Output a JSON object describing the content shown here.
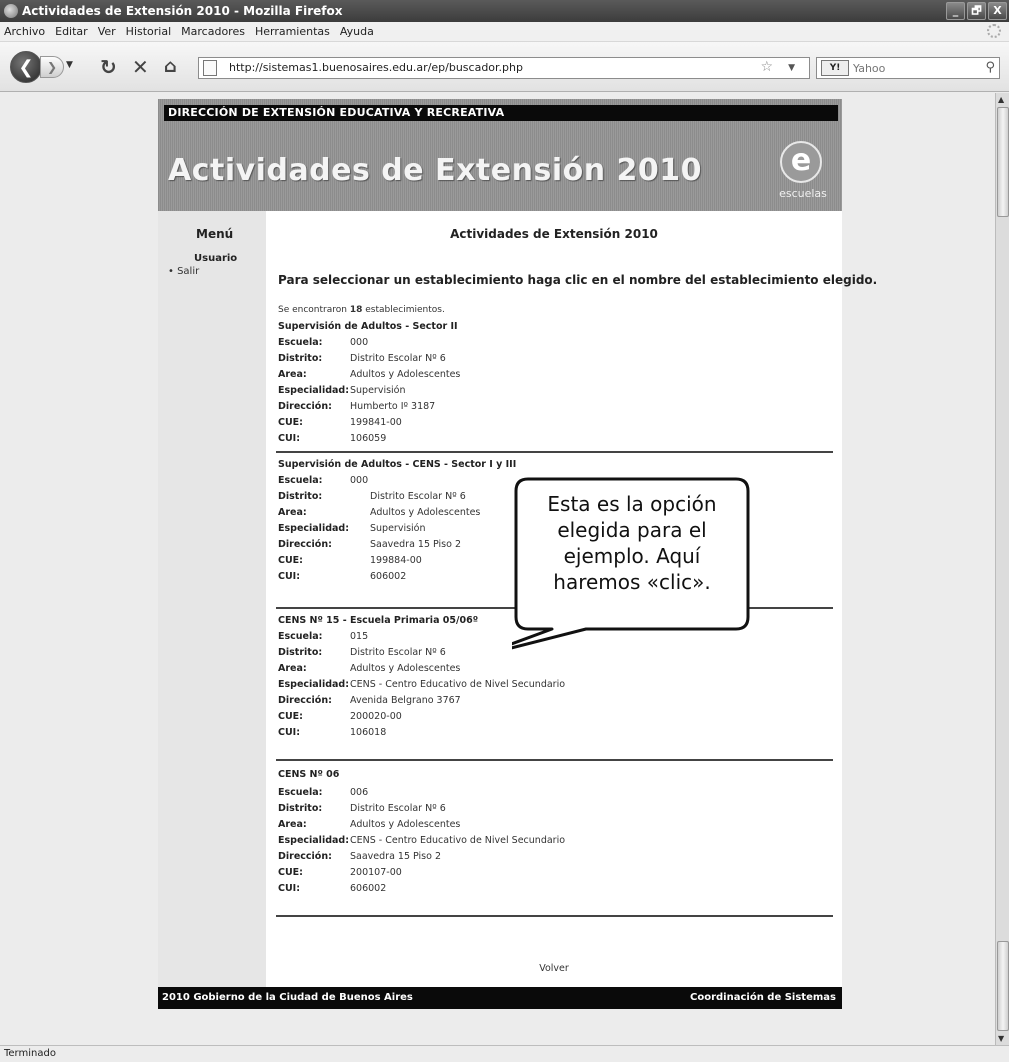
{
  "window": {
    "title": "Actividades de Extensión 2010 - Mozilla Firefox",
    "minimize": "_",
    "maximize": "🗗",
    "close": "X"
  },
  "menubar": [
    "Archivo",
    "Editar",
    "Ver",
    "Historial",
    "Marcadores",
    "Herramientas",
    "Ayuda"
  ],
  "navbar": {
    "url": "http://sistemas1.buenosaires.edu.ar/ep/buscador.php",
    "search_engine": "Y!",
    "search_placeholder": "Yahoo"
  },
  "page": {
    "dept_header": "DIRECCIÓN DE EXTENSIÓN EDUCATIVA Y RECREATIVA",
    "banner_title": "Actividades de Extensión 2010",
    "logo_letter": "e",
    "logo_word": "escuelas",
    "sidebar": {
      "menu_title": "Menú",
      "user_label": "Usuario",
      "logout": "• Salir"
    },
    "main_title": "Actividades de Extensión 2010",
    "instructions": "Para seleccionar un establecimiento haga clic en el nombre del establecimiento elegido.",
    "count_prefix": "Se encontraron ",
    "count_value": "18",
    "count_suffix": " establecimientos.",
    "labels": {
      "escuela": "Escuela:",
      "distrito": "Distrito:",
      "area": "Area:",
      "especialidad": "Especialidad:",
      "direccion": "Dirección:",
      "cue": "CUE:",
      "cui": "CUI:"
    },
    "records": [
      {
        "title": "Supervisión de Adultos - Sector II",
        "escuela": "000",
        "distrito": "Distrito Escolar Nº 6",
        "area": "Adultos y Adolescentes",
        "especialidad": "Supervisión",
        "direccion": "Humberto Iº 3187",
        "cue": "199841-00",
        "cui": "106059"
      },
      {
        "title": "Supervisión de Adultos - CENS - Sector I y III",
        "escuela": "000",
        "distrito": "Distrito Escolar Nº 6",
        "area": "Adultos y Adolescentes",
        "especialidad": "Supervisión",
        "direccion": "Saavedra 15 Piso 2",
        "cue": "199884-00",
        "cui": "606002"
      },
      {
        "title": "CENS Nº 15 - Escuela Primaria 05/06º",
        "escuela": "015",
        "distrito": "Distrito Escolar Nº 6",
        "area": "Adultos y Adolescentes",
        "especialidad": "CENS - Centro Educativo de Nivel Secundario",
        "direccion": "Avenida Belgrano 3767",
        "cue": "200020-00",
        "cui": "106018"
      },
      {
        "title": "CENS Nº 06",
        "escuela": "006",
        "distrito": "Distrito Escolar Nº 6",
        "area": "Adultos y Adolescentes",
        "especialidad": "CENS - Centro Educativo de Nivel Secundario",
        "direccion": "Saavedra 15 Piso 2",
        "cue": "200107-00",
        "cui": "606002"
      }
    ],
    "back_link": "Volver",
    "footer_left": "2010 Gobierno de la Ciudad de Buenos Aires",
    "footer_right": "Coordinación de Sistemas"
  },
  "callout": {
    "text": "Esta es la opción elegida para el ejemplo. Aquí haremos «clic»."
  },
  "statusbar": {
    "text": "Terminado"
  }
}
